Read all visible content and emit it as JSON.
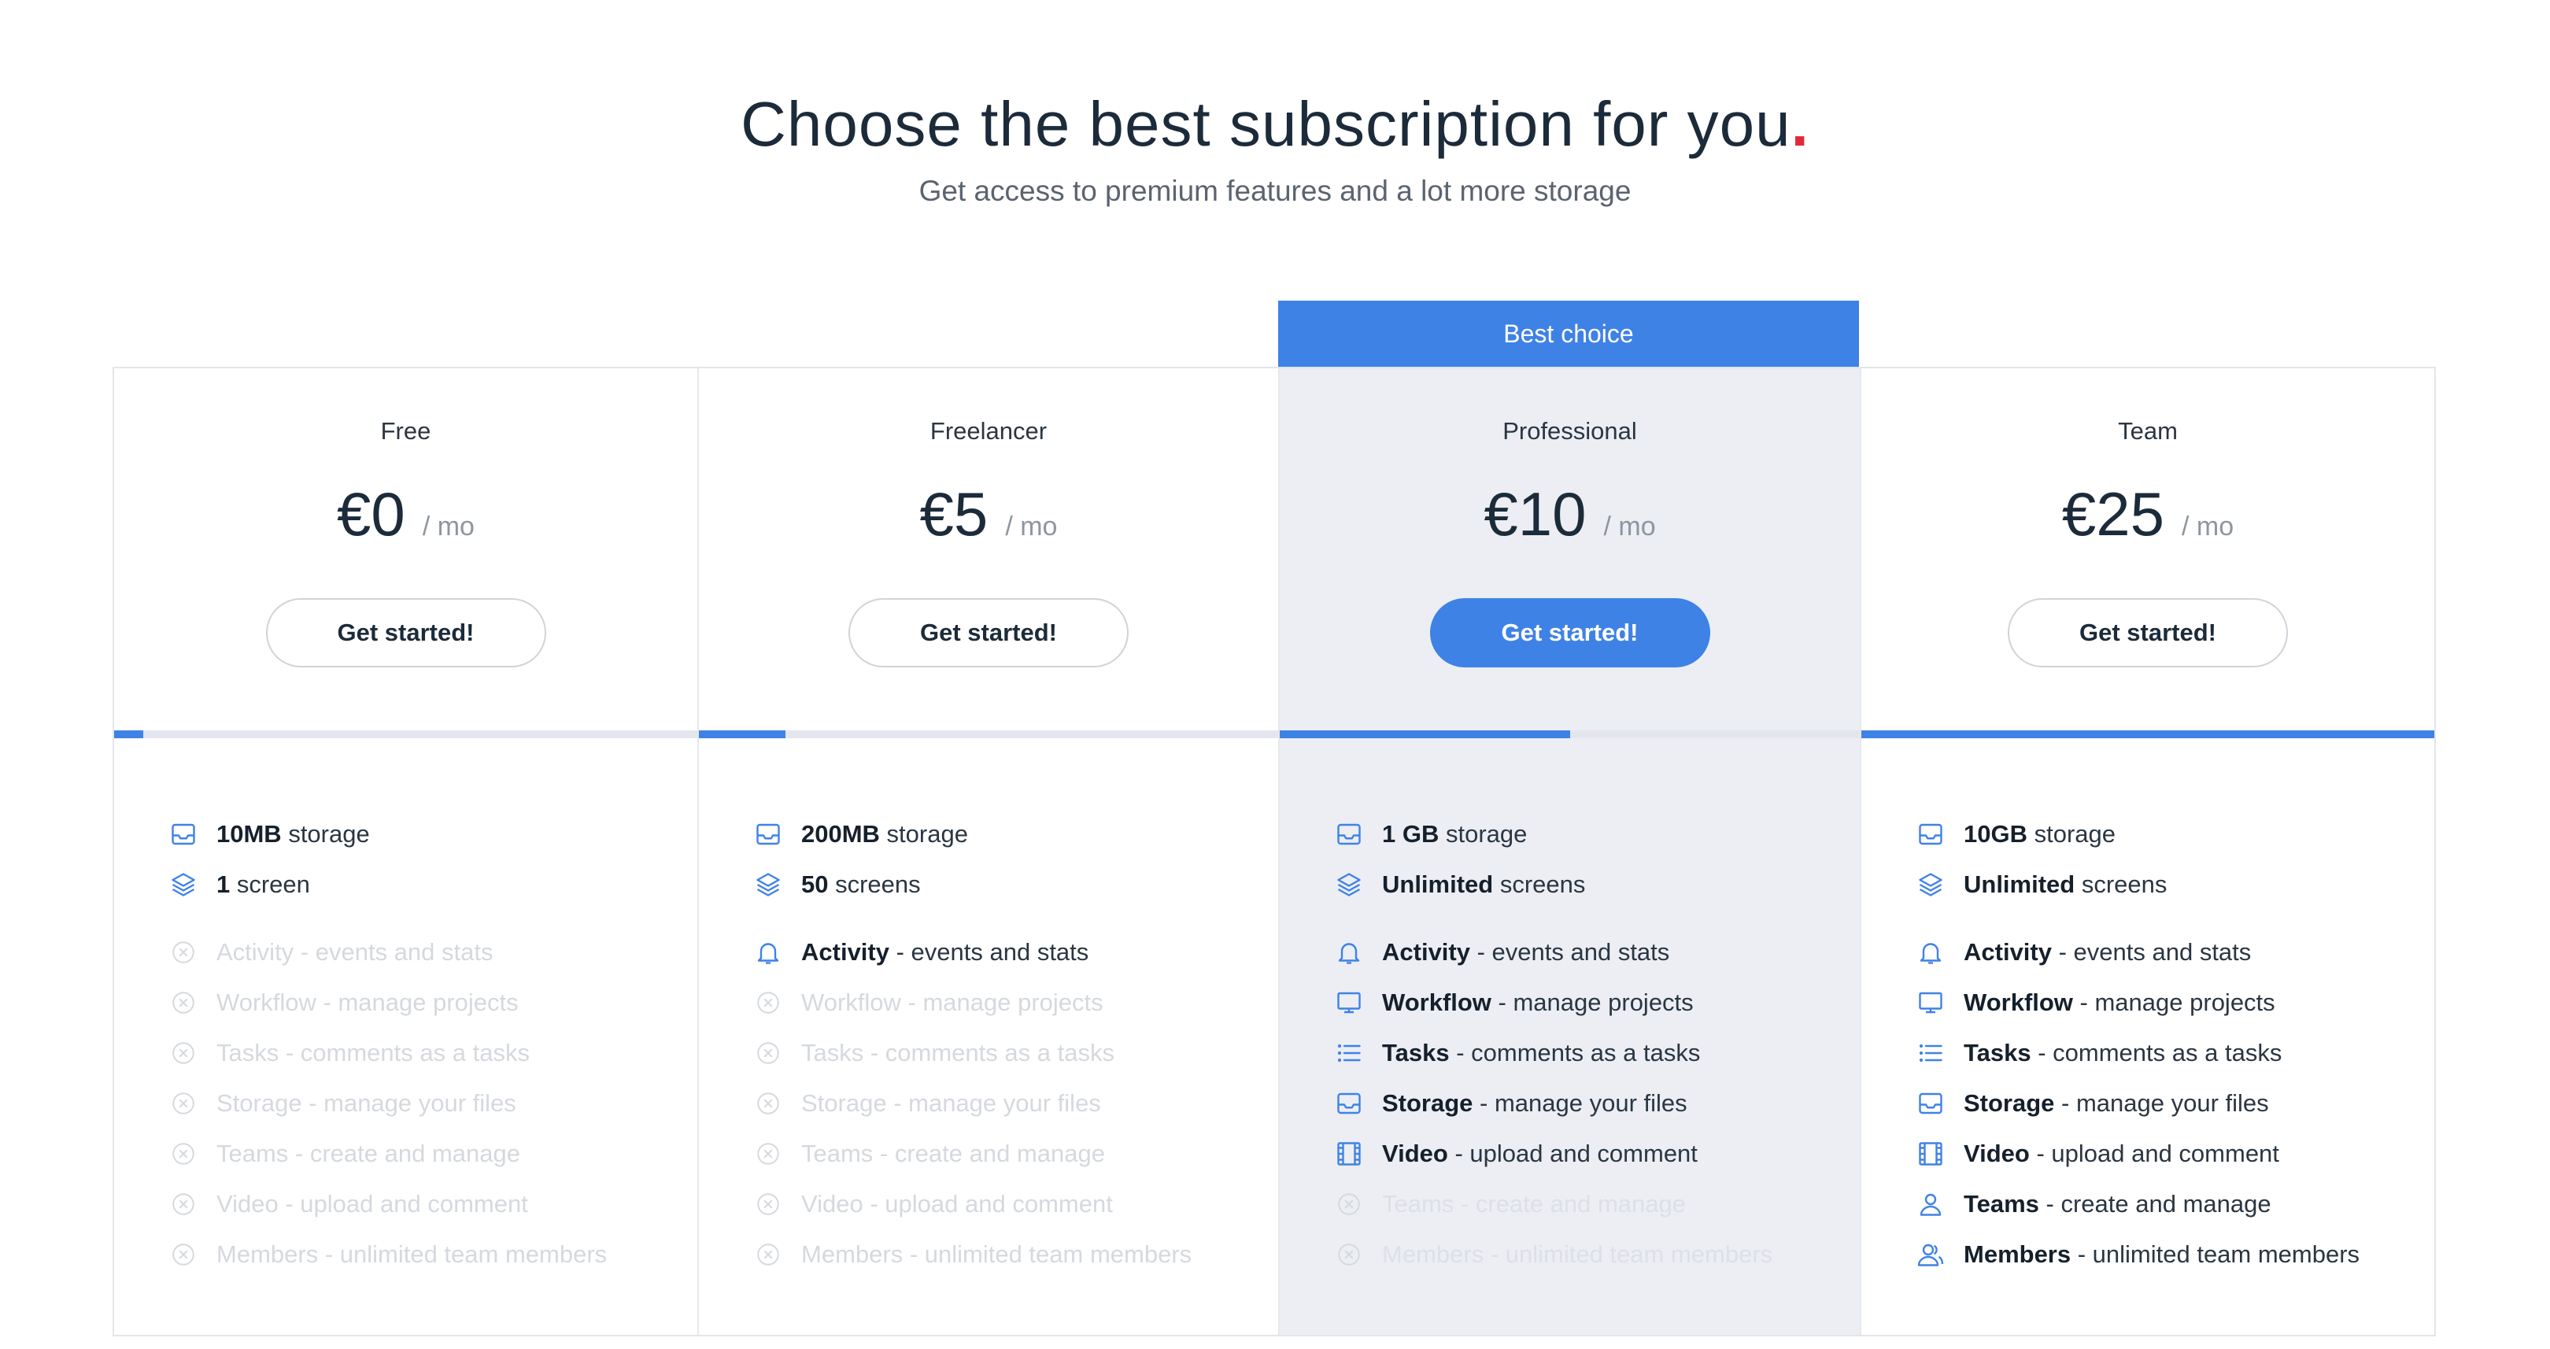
{
  "header": {
    "title": "Choose the best subscription for you",
    "title_dot": ".",
    "subtitle": "Get access to premium features and a lot more storage"
  },
  "badge": "Best choice",
  "colors": {
    "accent": "#3f82e6",
    "dot": "#e02a3c",
    "disabled": "#d5d9de"
  },
  "plans": [
    {
      "name": "Free",
      "price": "€0",
      "period": "/ mo",
      "cta": "Get started!",
      "usage_fraction": 0.05,
      "features": [
        {
          "strong": "10MB",
          "text": " storage",
          "icon": "inbox-icon",
          "enabled": true
        },
        {
          "strong": "1",
          "text": " screen",
          "icon": "layers-icon",
          "enabled": true
        },
        {
          "strong": "Activity",
          "text": " - events and stats",
          "icon": "x-circle-icon",
          "enabled": false
        },
        {
          "strong": "Workflow",
          "text": " - manage projects",
          "icon": "x-circle-icon",
          "enabled": false
        },
        {
          "strong": "Tasks",
          "text": " - comments as a tasks",
          "icon": "x-circle-icon",
          "enabled": false
        },
        {
          "strong": "Storage",
          "text": " - manage your files",
          "icon": "x-circle-icon",
          "enabled": false
        },
        {
          "strong": "Teams",
          "text": " - create and manage",
          "icon": "x-circle-icon",
          "enabled": false
        },
        {
          "strong": "Video",
          "text": " - upload and comment",
          "icon": "x-circle-icon",
          "enabled": false
        },
        {
          "strong": "Members",
          "text": " - unlimited team members",
          "icon": "x-circle-icon",
          "enabled": false
        }
      ]
    },
    {
      "name": "Freelancer",
      "price": "€5",
      "period": "/ mo",
      "cta": "Get started!",
      "usage_fraction": 0.15,
      "features": [
        {
          "strong": "200MB",
          "text": " storage",
          "icon": "inbox-icon",
          "enabled": true
        },
        {
          "strong": "50",
          "text": " screens",
          "icon": "layers-icon",
          "enabled": true
        },
        {
          "strong": "Activity",
          "text": " - events and stats",
          "icon": "bell-icon",
          "enabled": true
        },
        {
          "strong": "Workflow",
          "text": " - manage projects",
          "icon": "x-circle-icon",
          "enabled": false
        },
        {
          "strong": "Tasks",
          "text": " - comments as a tasks",
          "icon": "x-circle-icon",
          "enabled": false
        },
        {
          "strong": "Storage",
          "text": " - manage your files",
          "icon": "x-circle-icon",
          "enabled": false
        },
        {
          "strong": "Teams",
          "text": " - create and manage",
          "icon": "x-circle-icon",
          "enabled": false
        },
        {
          "strong": "Video",
          "text": " - upload and comment",
          "icon": "x-circle-icon",
          "enabled": false
        },
        {
          "strong": "Members",
          "text": " - unlimited team members",
          "icon": "x-circle-icon",
          "enabled": false
        }
      ]
    },
    {
      "name": "Professional",
      "price": "€10",
      "period": "/ mo",
      "cta": "Get started!",
      "usage_fraction": 0.5,
      "featured": true,
      "features": [
        {
          "strong": "1 GB",
          "text": " storage",
          "icon": "inbox-icon",
          "enabled": true
        },
        {
          "strong": "Unlimited",
          "text": " screens",
          "icon": "layers-icon",
          "enabled": true
        },
        {
          "strong": "Activity",
          "text": " - events and stats",
          "icon": "bell-icon",
          "enabled": true
        },
        {
          "strong": "Workflow",
          "text": " - manage projects",
          "icon": "monitor-icon",
          "enabled": true
        },
        {
          "strong": "Tasks",
          "text": " - comments as a tasks",
          "icon": "list-icon",
          "enabled": true
        },
        {
          "strong": "Storage",
          "text": " - manage your files",
          "icon": "inbox-icon",
          "enabled": true
        },
        {
          "strong": "Video",
          "text": " - upload and comment",
          "icon": "film-icon",
          "enabled": true
        },
        {
          "strong": "Teams",
          "text": " - create and manage",
          "icon": "x-circle-icon",
          "enabled": false
        },
        {
          "strong": "Members",
          "text": " - unlimited team members",
          "icon": "x-circle-icon",
          "enabled": false
        }
      ]
    },
    {
      "name": "Team",
      "price": "€25",
      "period": "/ mo",
      "cta": "Get started!",
      "usage_fraction": 1.0,
      "features": [
        {
          "strong": "10GB",
          "text": " storage",
          "icon": "inbox-icon",
          "enabled": true
        },
        {
          "strong": "Unlimited",
          "text": " screens",
          "icon": "layers-icon",
          "enabled": true
        },
        {
          "strong": "Activity",
          "text": " - events and stats",
          "icon": "bell-icon",
          "enabled": true
        },
        {
          "strong": "Workflow",
          "text": " - manage projects",
          "icon": "monitor-icon",
          "enabled": true
        },
        {
          "strong": "Tasks",
          "text": " - comments as a tasks",
          "icon": "list-icon",
          "enabled": true
        },
        {
          "strong": "Storage",
          "text": " - manage your files",
          "icon": "inbox-icon",
          "enabled": true
        },
        {
          "strong": "Video",
          "text": " - upload and comment",
          "icon": "film-icon",
          "enabled": true
        },
        {
          "strong": "Teams",
          "text": " - create and manage",
          "icon": "user-icon",
          "enabled": true
        },
        {
          "strong": "Members",
          "text": " - unlimited team members",
          "icon": "users-icon",
          "enabled": true
        }
      ]
    }
  ]
}
